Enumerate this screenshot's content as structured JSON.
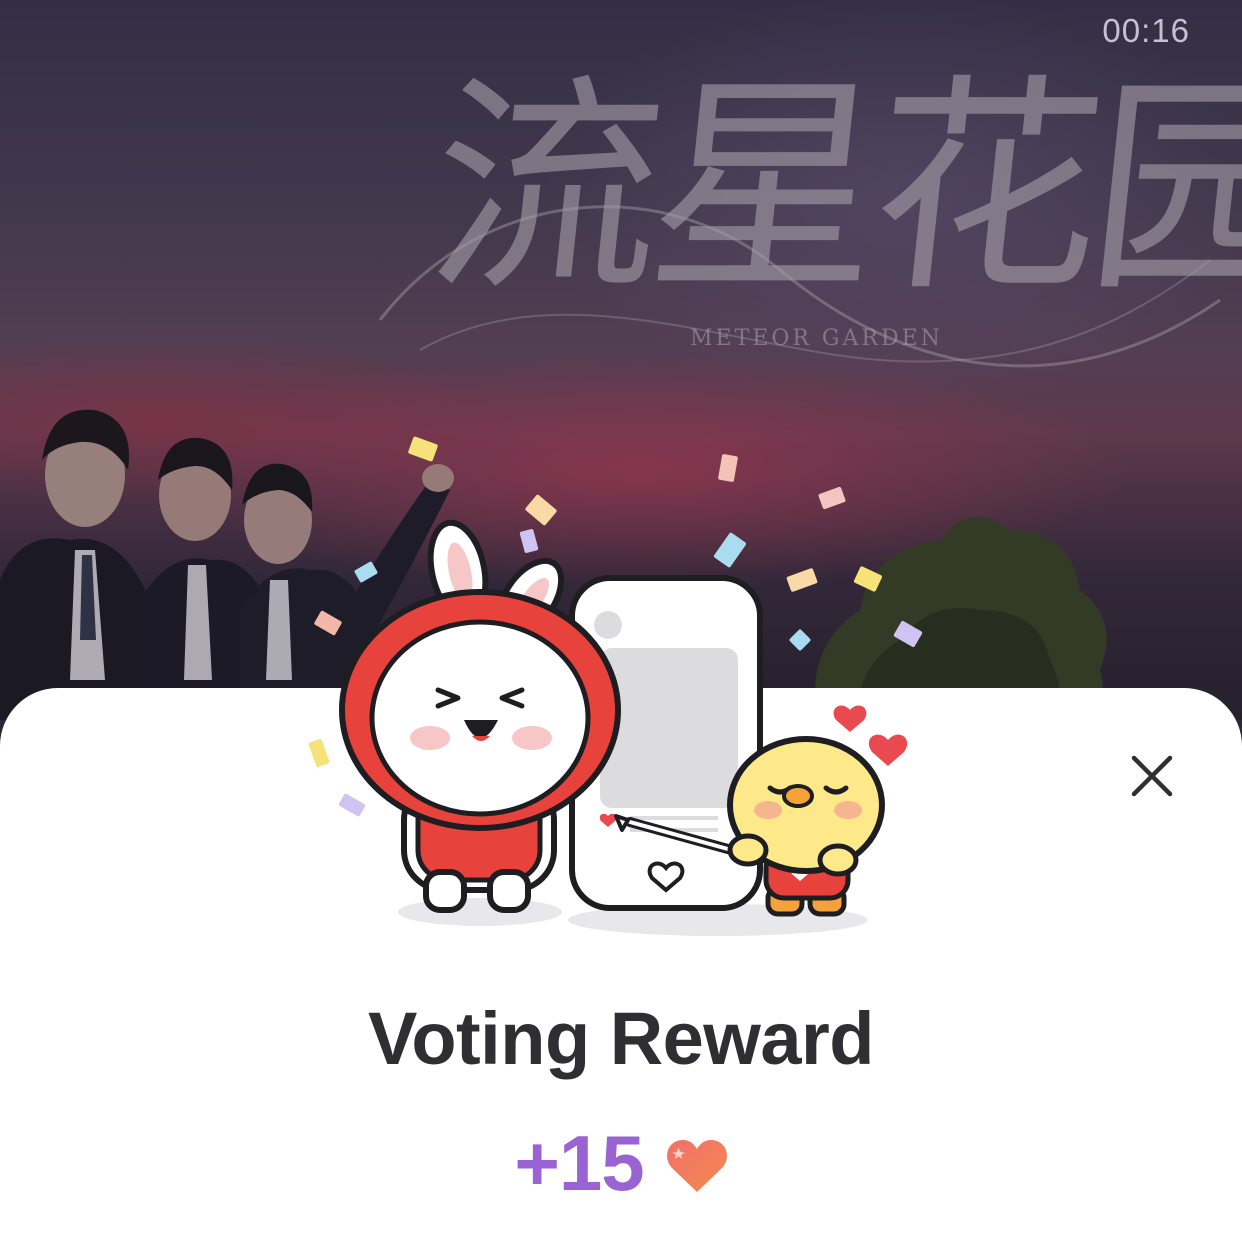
{
  "video": {
    "timer": "00:16",
    "title": "流星花园",
    "subtitle": "METEOR GARDEN"
  },
  "sheet": {
    "title": "Voting Reward",
    "reward_amount": "+15",
    "reward_icon": "heart-icon",
    "close_icon": "close-icon"
  },
  "colors": {
    "accent_purple": "#9a63d3",
    "heart_red": "#ee4f55",
    "title_text": "#2f2f33",
    "sheet_bg": "#ffffff"
  }
}
